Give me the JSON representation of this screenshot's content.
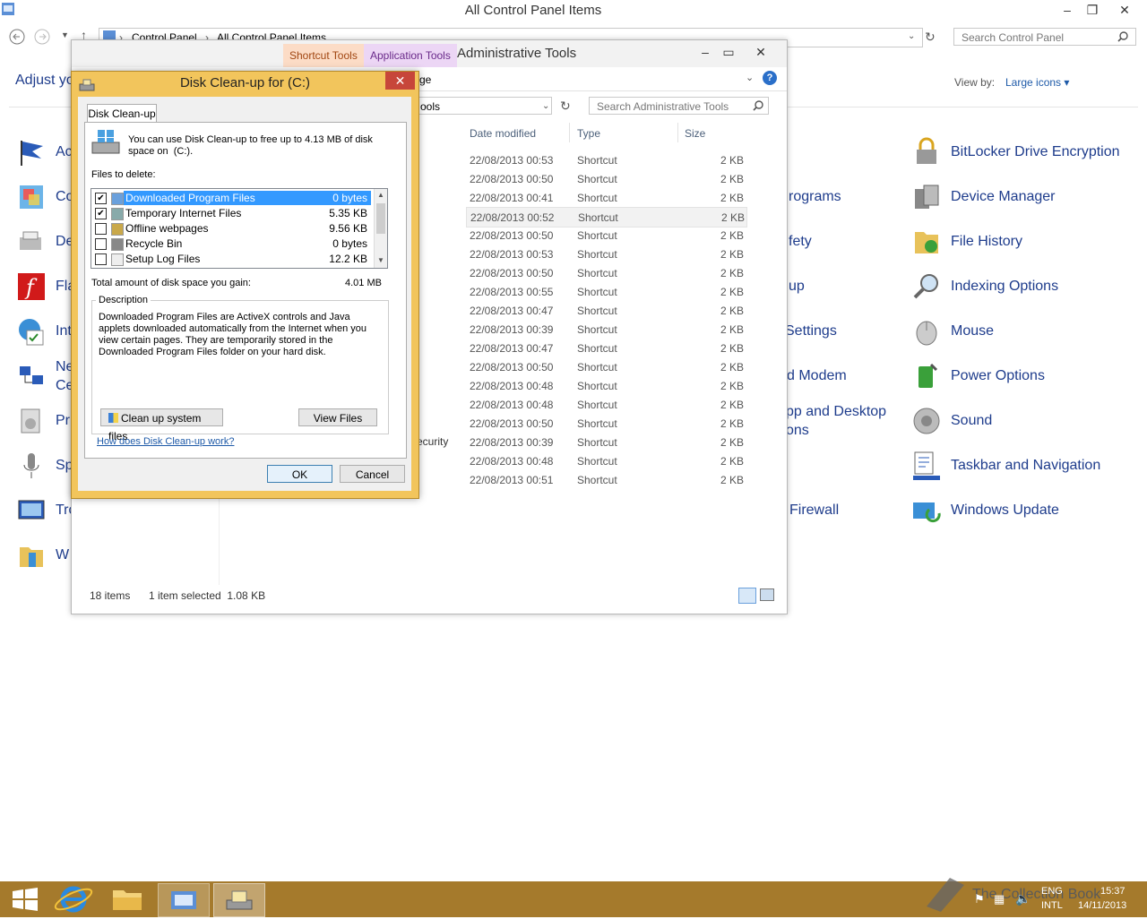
{
  "control_panel": {
    "title": "All Control Panel Items",
    "breadcrumb": [
      "Control Panel",
      "All Control Panel Items"
    ],
    "search_placeholder": "Search Control Panel",
    "adjust_label": "Adjust yo",
    "view_by_label": "View by:",
    "view_by_value": "Large icons ▾",
    "left_partials": [
      "Ac",
      "Co",
      "De",
      "Fla",
      "Int",
      "Ne",
      "Ce",
      "Pr",
      "Sp",
      "Tro",
      "W"
    ],
    "middle_partials": [
      "rograms",
      "fety",
      "up",
      "Settings",
      "d Modem",
      "pp and Desktop",
      "ons",
      "Firewall"
    ],
    "right_items": [
      "BitLocker Drive Encryption",
      "Device Manager",
      "File History",
      "Indexing Options",
      "Mouse",
      "Power Options",
      "Sound",
      "Taskbar and Navigation",
      "Windows Update"
    ]
  },
  "admin_tools": {
    "title": "Administrative Tools",
    "ctx_tabs": [
      "Shortcut Tools",
      "Application Tools"
    ],
    "ribbon_partial": "ge",
    "address_partial": "ools",
    "search_placeholder": "Search Administrative Tools",
    "columns": [
      "Date modified",
      "Type",
      "Size"
    ],
    "partial_name": "ecurity",
    "rows": [
      {
        "date": "22/08/2013 00:53",
        "type": "Shortcut",
        "size": "2 KB"
      },
      {
        "date": "22/08/2013 00:50",
        "type": "Shortcut",
        "size": "2 KB"
      },
      {
        "date": "22/08/2013 00:41",
        "type": "Shortcut",
        "size": "2 KB"
      },
      {
        "date": "22/08/2013 00:52",
        "type": "Shortcut",
        "size": "2 KB"
      },
      {
        "date": "22/08/2013 00:50",
        "type": "Shortcut",
        "size": "2 KB"
      },
      {
        "date": "22/08/2013 00:53",
        "type": "Shortcut",
        "size": "2 KB"
      },
      {
        "date": "22/08/2013 00:50",
        "type": "Shortcut",
        "size": "2 KB"
      },
      {
        "date": "22/08/2013 00:55",
        "type": "Shortcut",
        "size": "2 KB"
      },
      {
        "date": "22/08/2013 00:47",
        "type": "Shortcut",
        "size": "2 KB"
      },
      {
        "date": "22/08/2013 00:39",
        "type": "Shortcut",
        "size": "2 KB"
      },
      {
        "date": "22/08/2013 00:47",
        "type": "Shortcut",
        "size": "2 KB"
      },
      {
        "date": "22/08/2013 00:50",
        "type": "Shortcut",
        "size": "2 KB"
      },
      {
        "date": "22/08/2013 00:48",
        "type": "Shortcut",
        "size": "2 KB"
      },
      {
        "date": "22/08/2013 00:48",
        "type": "Shortcut",
        "size": "2 KB"
      },
      {
        "date": "22/08/2013 00:50",
        "type": "Shortcut",
        "size": "2 KB"
      },
      {
        "date": "22/08/2013 00:39",
        "type": "Shortcut",
        "size": "2 KB"
      },
      {
        "date": "22/08/2013 00:48",
        "type": "Shortcut",
        "size": "2 KB"
      },
      {
        "date": "22/08/2013 00:51",
        "type": "Shortcut",
        "size": "2 KB"
      }
    ],
    "status_count": "18 items",
    "status_selected": "1 item selected  1.08 KB"
  },
  "disk_cleanup": {
    "title": "Disk Clean-up for  (C:)",
    "tab": "Disk Clean-up",
    "intro_line1": "You can use Disk Clean-up to free up to 4.13 MB of disk",
    "intro_line2": "space on  (C:).",
    "files_label": "Files to delete:",
    "items": [
      {
        "name": "Downloaded Program Files",
        "size": "0 bytes",
        "checked": "✔"
      },
      {
        "name": "Temporary Internet Files",
        "size": "5.35 KB",
        "checked": "✔"
      },
      {
        "name": "Offline webpages",
        "size": "9.56 KB",
        "checked": ""
      },
      {
        "name": "Recycle Bin",
        "size": "0 bytes",
        "checked": ""
      },
      {
        "name": "Setup Log Files",
        "size": "12.2 KB",
        "checked": ""
      }
    ],
    "total_label": "Total amount of disk space you gain:",
    "total_value": "4.01 MB",
    "desc_label": "Description",
    "desc_text": "Downloaded Program Files are ActiveX controls and Java applets downloaded automatically from the Internet when you view certain pages. They are temporarily stored in the Downloaded Program Files folder on your hard disk.",
    "cleanup_sys_btn": "Clean up system files",
    "view_files_btn": "View Files",
    "help_link": "How does Disk Clean-up work?",
    "ok_btn": "OK",
    "cancel_btn": "Cancel"
  },
  "taskbar": {
    "lang_top": "ENG",
    "lang_bottom": "INTL",
    "time": "15:37",
    "date": "14/11/2013",
    "watermark": "The Collection Book"
  },
  "colors": {
    "link": "#1e3c8c",
    "dialog_frame": "#f2c55c",
    "taskbar": "#a57a2c",
    "selection": "#3399ff"
  }
}
